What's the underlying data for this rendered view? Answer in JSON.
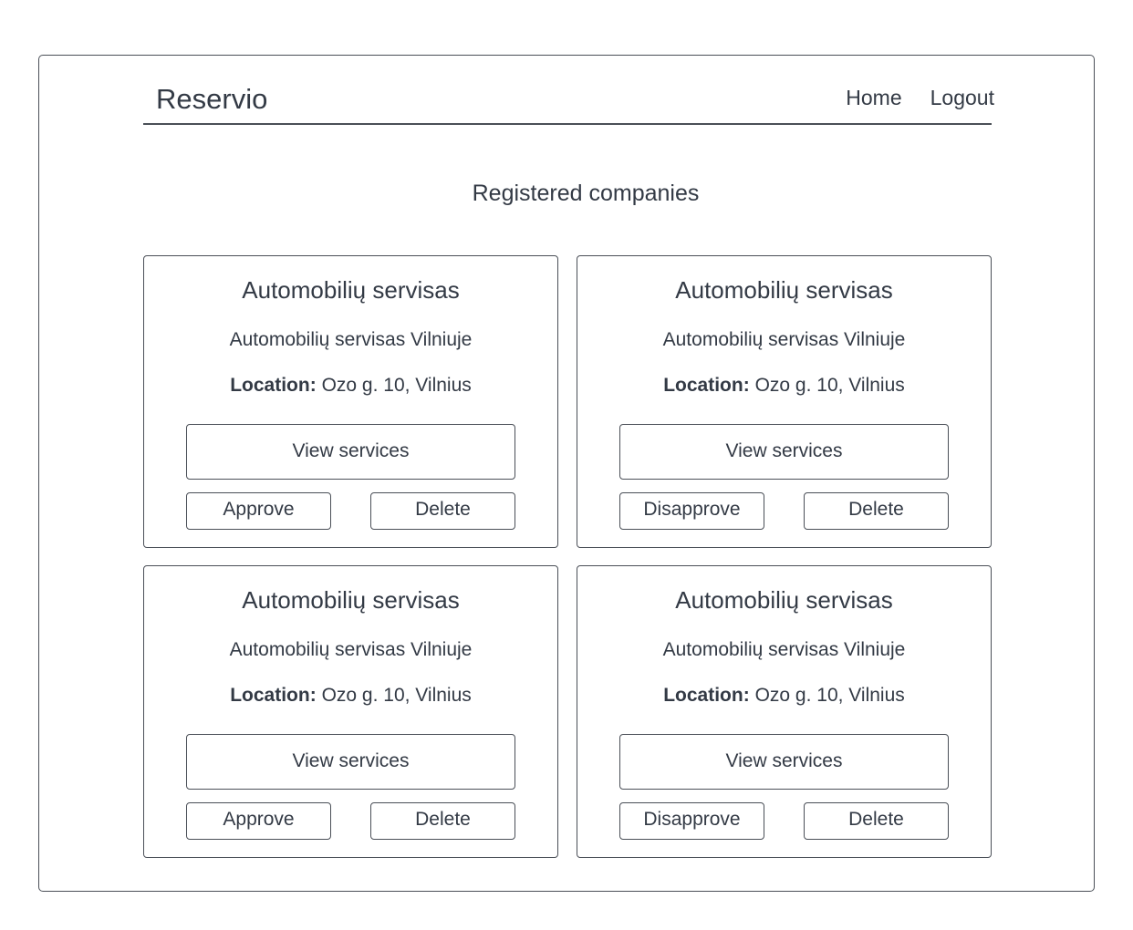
{
  "navbar": {
    "brand": "Reservio",
    "links": [
      "Home",
      "Logout"
    ]
  },
  "page": {
    "title": "Registered companies"
  },
  "companies": [
    {
      "name": "Automobilių servisas",
      "description": "Automobilių servisas Vilniuje",
      "location_label": "Location:",
      "location": "Ozo g. 10, Vilnius",
      "view_label": "View services",
      "approval_action": "Approve",
      "delete_label": "Delete"
    },
    {
      "name": "Automobilių servisas",
      "description": "Automobilių servisas Vilniuje",
      "location_label": "Location:",
      "location": "Ozo g. 10, Vilnius",
      "view_label": "View services",
      "approval_action": "Disapprove",
      "delete_label": "Delete"
    },
    {
      "name": "Automobilių servisas",
      "description": "Automobilių servisas Vilniuje",
      "location_label": "Location:",
      "location": "Ozo g. 10, Vilnius",
      "view_label": "View services",
      "approval_action": "Approve",
      "delete_label": "Delete"
    },
    {
      "name": "Automobilių servisas",
      "description": "Automobilių servisas Vilniuje",
      "location_label": "Location:",
      "location": "Ozo g. 10, Vilnius",
      "view_label": "View services",
      "approval_action": "Disapprove",
      "delete_label": "Delete"
    }
  ]
}
